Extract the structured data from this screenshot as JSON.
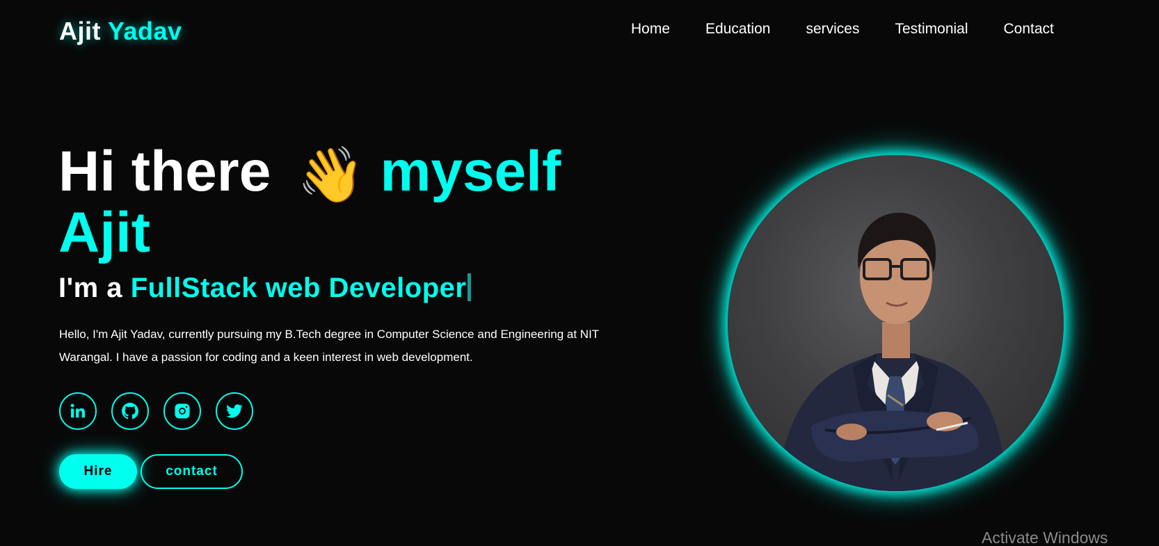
{
  "logo": {
    "first": "Ajit",
    "last": "Yadav"
  },
  "nav": {
    "items": [
      "Home",
      "Education",
      "services",
      "Testimonial",
      "Contact"
    ]
  },
  "hero": {
    "greeting": "Hi there",
    "wave_emoji": "👋",
    "myself": "myself",
    "name": "Ajit",
    "role_prefix": "I'm a",
    "role": "FullStack web Developer",
    "bio": "Hello, I'm Ajit Yadav, currently pursuing my B.Tech degree in Computer Science and Engineering at NIT Warangal. I have a passion for coding and a keen interest in web development."
  },
  "socials": [
    "linkedin-icon",
    "github-icon",
    "instagram-icon",
    "twitter-icon"
  ],
  "buttons": {
    "hire": "Hire",
    "contact": "contact"
  },
  "watermark": "Activate Windows",
  "colors": {
    "accent": "#00ffee",
    "background": "#080808",
    "text": "#ffffff"
  }
}
